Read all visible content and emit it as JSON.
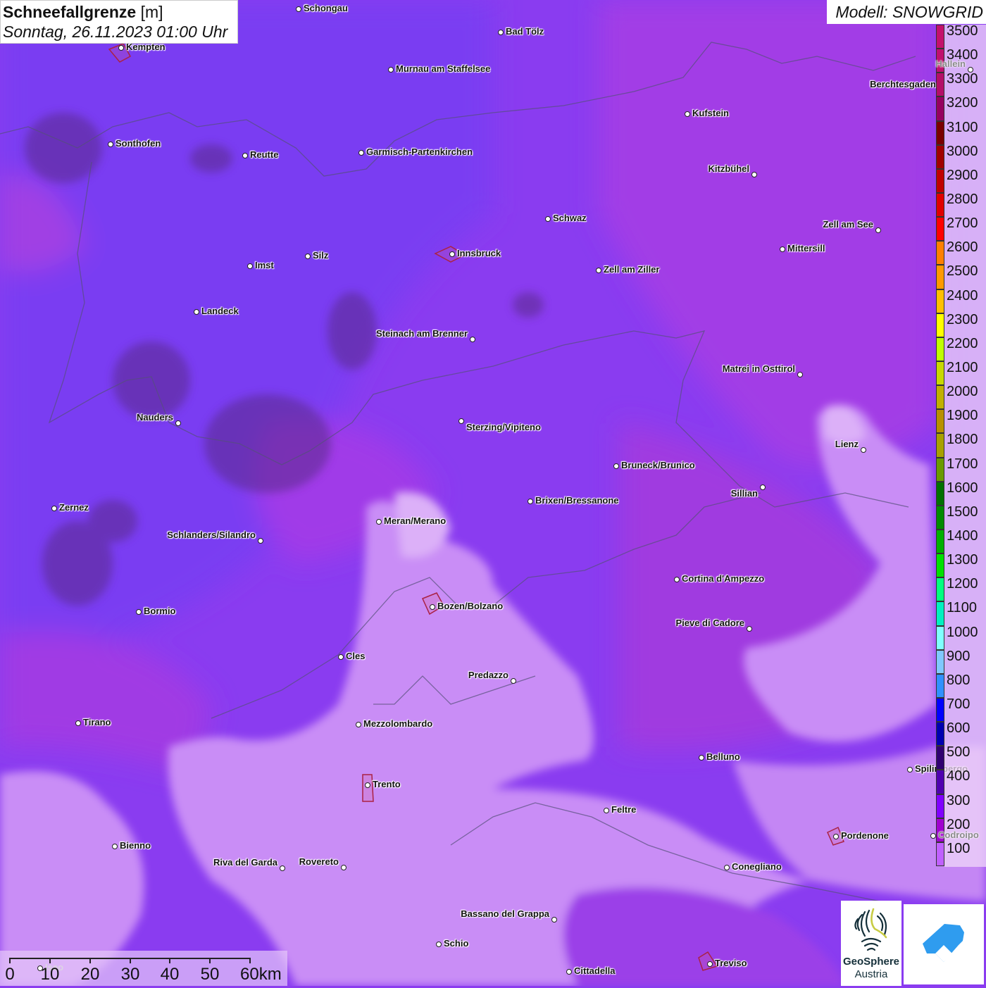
{
  "header": {
    "title": "Schneefallgrenze",
    "unit": "[m]",
    "datetime": "Sonntag, 26.11.2023 01:00 Uhr"
  },
  "model": "Modell: SNOWGRID",
  "legend": {
    "labels": [
      "3500",
      "3400",
      "3300",
      "3200",
      "3100",
      "3000",
      "2900",
      "2800",
      "2700",
      "2600",
      "2500",
      "2400",
      "2300",
      "2200",
      "2100",
      "2000",
      "1900",
      "1800",
      "1700",
      "1600",
      "1500",
      "1400",
      "1300",
      "1200",
      "1100",
      "1000",
      "900",
      "800",
      "700",
      "600",
      "500",
      "400",
      "300",
      "200",
      "100"
    ],
    "colors": [
      "#c4106c",
      "#c0106e",
      "#b40f68",
      "#960060",
      "#7a0000",
      "#a00000",
      "#c00000",
      "#e00000",
      "#ff0000",
      "#ff7f00",
      "#ff9900",
      "#ffbf00",
      "#ffff00",
      "#bfff00",
      "#c8d800",
      "#c0b000",
      "#b89000",
      "#a8a000",
      "#6a9a00",
      "#007000",
      "#008a00",
      "#00b000",
      "#00e000",
      "#00ff80",
      "#00f0c0",
      "#80ffff",
      "#80c8ff",
      "#3090ff",
      "#0000ff",
      "#0000b0",
      "#300070",
      "#5000b0",
      "#8000ff",
      "#a000d0",
      "#c060ff"
    ]
  },
  "cities": [
    "Schongau",
    "Bad Tölz",
    "Kempten",
    "Murnau am Staffelsee",
    "Hallein",
    "Berchtesgaden",
    "Kufstein",
    "Sonthofen",
    "Reutte",
    "Garmisch-Partenkirchen",
    "Kitzbühel",
    "Schwaz",
    "Zell am See",
    "Mittersill",
    "Innsbruck",
    "Silz",
    "Imst",
    "Zell am Ziller",
    "Landeck",
    "Steinach am Brenner",
    "Matrei in Osttirol",
    "Nauders",
    "Sterzing/Vipiteno",
    "Lienz",
    "Bruneck/Brunico",
    "Sillian",
    "Brixen/Bressanone",
    "Zernez",
    "Meran/Merano",
    "Schlanders/Silandro",
    "Cortina d'Ampezzo",
    "Bozen/Bolzano",
    "Bormio",
    "Pieve di Cadore",
    "Cles",
    "Predazzo",
    "Tirano",
    "Mezzolombardo",
    "Belluno",
    "Spilimbergo",
    "Trento",
    "Feltre",
    "Pordenone",
    "Codroipo",
    "Bienno",
    "Riva del Garda",
    "Rovereto",
    "Conegliano",
    "Bassano del Grappa",
    "Schio",
    "Treviso",
    "Cittadella",
    "Iseo"
  ],
  "scale": {
    "labels": [
      "0",
      "10",
      "20",
      "30",
      "40",
      "50",
      "60km"
    ]
  },
  "logos": {
    "geosphere_line1": "GeoSphere",
    "geosphere_line2": "Austria"
  }
}
